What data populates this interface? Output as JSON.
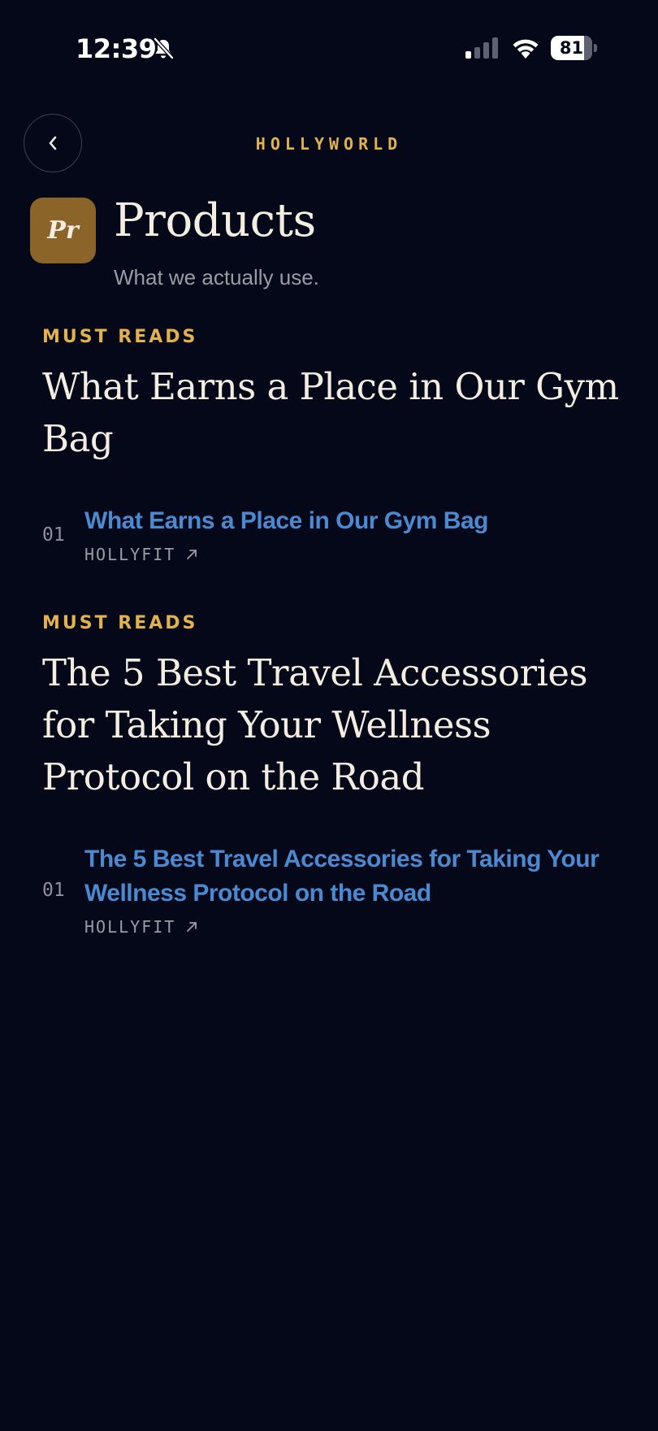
{
  "status_bar": {
    "time": "12:39",
    "battery_level": "81",
    "battery_fraction": 0.81
  },
  "header": {
    "brand": "HOLLYWORLD",
    "back_icon": "chevron-left-icon"
  },
  "page": {
    "badge": "Pr",
    "title": "Products",
    "subtitle": "What we actually use."
  },
  "sections": [
    {
      "label": "MUST READS",
      "heading": "What Earns a Place in Our Gym Bag",
      "articles": [
        {
          "number": "01",
          "title": "What Earns a Place in Our Gym Bag",
          "source": "HOLLYFIT"
        }
      ]
    },
    {
      "label": "MUST READS",
      "heading": "The 5 Best Travel Accessories for Taking Your Wellness Protocol on the Road",
      "articles": [
        {
          "number": "01",
          "title": "The 5 Best Travel Accessories for Taking Your Wellness Protocol on the Road",
          "source": "HOLLYFIT"
        }
      ]
    }
  ],
  "colors": {
    "background": "#040818",
    "accent_gold": "#e3b24a",
    "link_blue": "#4b8ad1",
    "badge_brown": "#8a6428",
    "text_primary": "#f3ede2",
    "text_muted": "#9a9ca4"
  }
}
